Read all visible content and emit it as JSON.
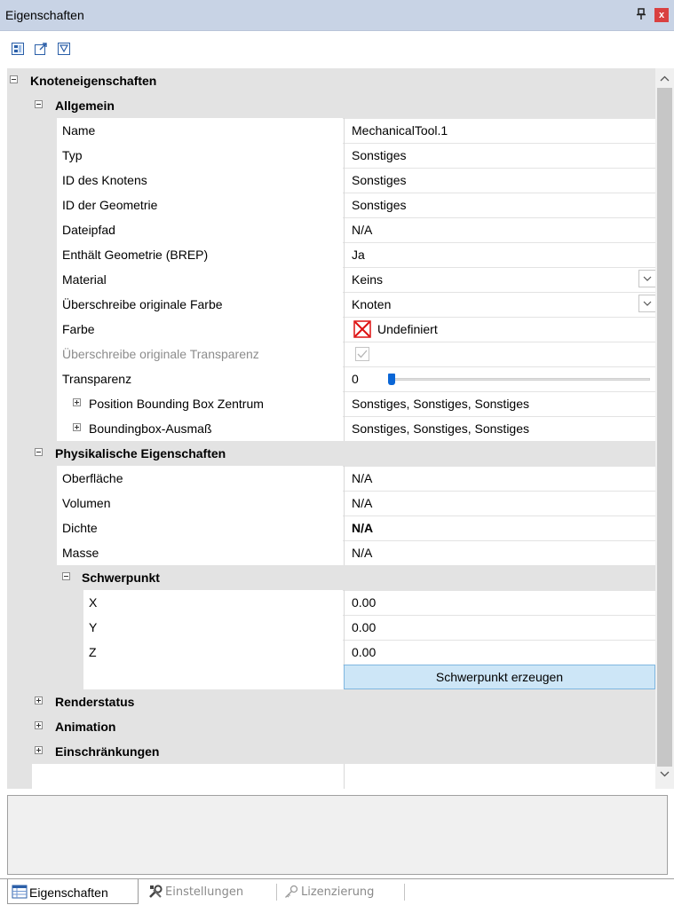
{
  "window": {
    "title": "Eigenschaften",
    "pin_glyph": "ᵽ",
    "close_glyph": "x"
  },
  "toolbar": {
    "icons": [
      "categorize-icon",
      "popout-icon",
      "filter-icon"
    ]
  },
  "grid": {
    "section": "Knoteneigenschaften",
    "allgemein": {
      "label": "Allgemein",
      "name": {
        "label": "Name",
        "value": "MechanicalTool.1"
      },
      "typ": {
        "label": "Typ",
        "value": "Sonstiges"
      },
      "id_knoten": {
        "label": "ID des Knotens",
        "value": "Sonstiges"
      },
      "id_geometrie": {
        "label": "ID der Geometrie",
        "value": "Sonstiges"
      },
      "dateipfad": {
        "label": "Dateipfad",
        "value": "N/A"
      },
      "brep": {
        "label": "Enthält Geometrie (BREP)",
        "value": "Ja"
      },
      "material": {
        "label": "Material",
        "value": "Keins"
      },
      "farbe_override": {
        "label": "Überschreibe originale Farbe",
        "value": "Knoten"
      },
      "farbe": {
        "label": "Farbe",
        "value": "Undefiniert"
      },
      "transparenz_override": {
        "label": "Überschreibe originale Transparenz",
        "checked": true
      },
      "transparenz": {
        "label": "Transparenz",
        "value": "0",
        "slider_level": 0.0
      },
      "bbox_center": {
        "label": "Position Bounding Box Zentrum",
        "value": "Sonstiges, Sonstiges, Sonstiges"
      },
      "bbox_extent": {
        "label": "Boundingbox-Ausmaß",
        "value": "Sonstiges, Sonstiges, Sonstiges"
      }
    },
    "physikalisch": {
      "label": "Physikalische Eigenschaften",
      "oberflaeche": {
        "label": "Oberfläche",
        "value": "N/A"
      },
      "volumen": {
        "label": "Volumen",
        "value": "N/A"
      },
      "dichte": {
        "label": "Dichte",
        "value": "N/A"
      },
      "masse": {
        "label": "Masse",
        "value": "N/A"
      },
      "schwerpunkt": {
        "label": "Schwerpunkt",
        "x": {
          "label": "X",
          "value": "0.00"
        },
        "y": {
          "label": "Y",
          "value": "0.00"
        },
        "z": {
          "label": "Z",
          "value": "0.00"
        },
        "button": "Schwerpunkt erzeugen"
      }
    },
    "renderstatus": "Renderstatus",
    "animation": "Animation",
    "einschraenkungen": "Einschränkungen"
  },
  "tabs": [
    {
      "label": "Eigenschaften",
      "icon": "grid-icon",
      "active": true
    },
    {
      "label": "Einstellungen",
      "icon": "tools-icon",
      "active": false
    },
    {
      "label": "Lizenzierung",
      "icon": "key-icon",
      "active": false
    }
  ],
  "colors": {
    "category_bg": "#e3e3e3",
    "title_bg": "#c8d3e5",
    "button_bg": "#cde6f7",
    "accent": "#0a66d6"
  }
}
